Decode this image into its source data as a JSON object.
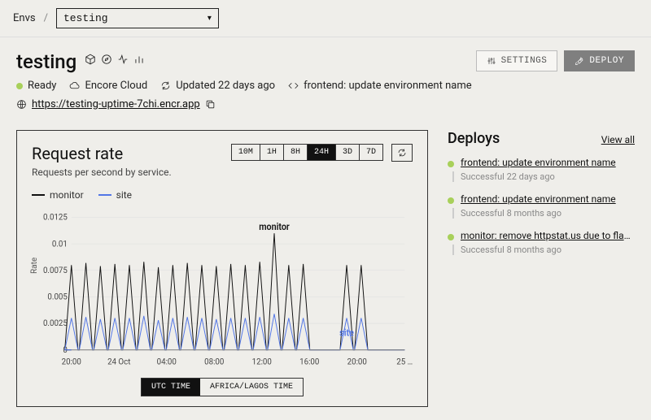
{
  "breadcrumb": {
    "root": "Envs",
    "sep": "/"
  },
  "env_selector": {
    "value": "testing"
  },
  "header": {
    "title": "testing",
    "status_label": "Ready",
    "cloud_label": "Encore Cloud",
    "updated_label": "Updated 22 days ago",
    "commit_label": "frontend: update environment name",
    "url": "https://testing-uptime-7chi.encr.app"
  },
  "actions": {
    "settings": "SETTINGS",
    "deploy": "DEPLOY"
  },
  "chart": {
    "title": "Request rate",
    "subtitle": "Requests per second by service.",
    "ranges": [
      "10M",
      "1H",
      "8H",
      "24H",
      "3D",
      "7D"
    ],
    "active_range": "24H",
    "legend": {
      "monitor": "monitor",
      "site": "site"
    },
    "ylabel": "Rate",
    "tz": {
      "utc": "UTC TIME",
      "local": "AFRICA/LAGOS TIME",
      "active": "utc"
    }
  },
  "chart_data": {
    "type": "line",
    "xlabel": "",
    "ylabel": "Rate",
    "ylim": [
      0,
      0.0125
    ],
    "y_ticks": [
      0,
      0.0025,
      0.005,
      0.0075,
      0.01,
      0.0125
    ],
    "x_tick_labels": [
      "20:00",
      "24 Oct",
      "04:00",
      "08:00",
      "12:00",
      "16:00",
      "20:00",
      "25 …"
    ],
    "annotations": [
      {
        "text": "monitor",
        "x_index": 14,
        "y": 0.011
      },
      {
        "text": "site",
        "x_index": 19,
        "y": 0.001
      }
    ],
    "x": [
      0,
      1,
      2,
      3,
      4,
      5,
      6,
      7,
      8,
      9,
      10,
      11,
      12,
      13,
      14,
      15,
      16,
      17,
      18,
      19,
      20,
      21,
      22,
      23
    ],
    "series": [
      {
        "name": "monitor",
        "color": "#111111",
        "values": [
          0.008,
          0.0082,
          0.0079,
          0.0081,
          0.008,
          0.0083,
          0.0078,
          0.008,
          0.0082,
          0.008,
          0.0079,
          0.0081,
          0.008,
          0.0083,
          0.011,
          0.008,
          0.0081,
          0,
          0,
          0.008,
          0.008,
          0,
          0,
          0
        ]
      },
      {
        "name": "site",
        "color": "#5276e6",
        "values": [
          0.003,
          0.0031,
          0.0029,
          0.003,
          0.003,
          0.0032,
          0.0028,
          0.003,
          0.0031,
          0.003,
          0.0029,
          0.003,
          0.003,
          0.0031,
          0.0034,
          0.003,
          0.003,
          0,
          0,
          0.003,
          0.003,
          0,
          0,
          0
        ]
      }
    ]
  },
  "deploys": {
    "title": "Deploys",
    "view_all": "View all",
    "items": [
      {
        "title": "frontend: update environment name",
        "status": "Successful 22 days ago"
      },
      {
        "title": "frontend: update environment name",
        "status": "Successful 8 months ago"
      },
      {
        "title": "monitor: remove httpstat.us due to flak…",
        "status": "Successful 8 months ago"
      }
    ]
  }
}
